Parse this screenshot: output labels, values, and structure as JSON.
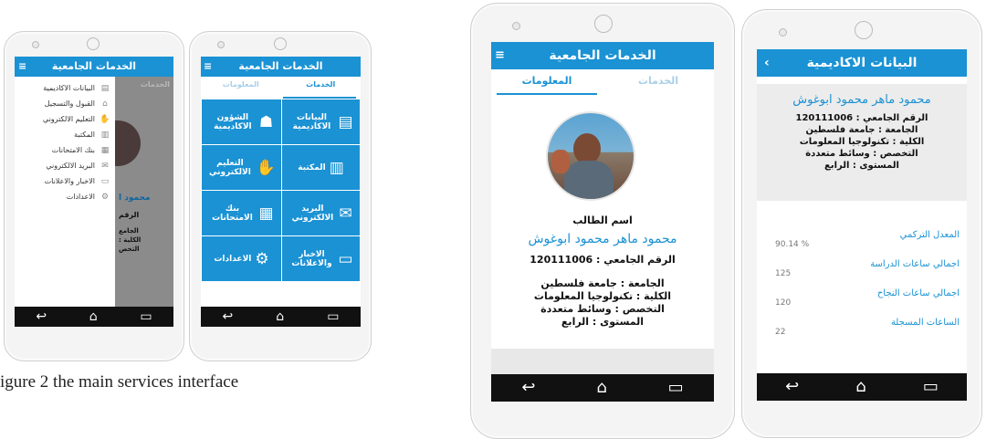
{
  "caption": "igure 2 the main services interface",
  "phone1": {
    "header_title": "الخدمات الجامعية",
    "menu_icon": "hamburger-icon",
    "behind_tab": "الخدمات",
    "behind_name": "محمود ا",
    "behind_lines": [
      "الرقم",
      "الجامع",
      "الكلية :",
      "التخص"
    ],
    "menu": [
      {
        "label": "البيانات الاكاديمية",
        "icon": "id-card-icon"
      },
      {
        "label": "القبول والتسجيل",
        "icon": "building-icon"
      },
      {
        "label": "التعليم الالكتروني",
        "icon": "handshake-icon"
      },
      {
        "label": "المكتبة",
        "icon": "books-icon"
      },
      {
        "label": "بنك الامتحانات",
        "icon": "document-icon"
      },
      {
        "label": "البريد الالكتروني",
        "icon": "envelope-icon"
      },
      {
        "label": "الاخبار والاعلانات",
        "icon": "monitor-icon"
      },
      {
        "label": "الاعدادات",
        "icon": "gear-icon"
      }
    ]
  },
  "phone2": {
    "header_title": "الخدمات الجامعية",
    "tab_services": "الخدمات",
    "tab_info": "المعلومات",
    "tiles": [
      {
        "label": "البيانات الاكاديمية",
        "icon": "id-card-icon"
      },
      {
        "label": "الشؤون الاكاديمية",
        "icon": "people-icon"
      },
      {
        "label": "المكتبة",
        "icon": "books-icon"
      },
      {
        "label": "التعليم الالكتروني",
        "icon": "handshake-icon"
      },
      {
        "label": "البريد الالكتروني",
        "icon": "envelope-icon"
      },
      {
        "label": "بنك الامتحانات",
        "icon": "document-icon"
      },
      {
        "label": "الاخبار والاعلانات",
        "icon": "monitor-icon"
      },
      {
        "label": "الاعدادات",
        "icon": "gear-icon"
      }
    ]
  },
  "phone3": {
    "header_title": "الخدمات الجامعية",
    "tab_services": "الخدمات",
    "tab_info": "المعلومات",
    "student_label": "اسم الطالب",
    "student_name": "محمود ماهر محمود ابوغوش",
    "lines": [
      "الرقم الجامعي : 120111006",
      "الجامعة : جامعة فلسطين",
      "الكلية : تكنولوجيا المعلومات",
      "التخصص : وسائط متعددة",
      "المستوى : الرابع"
    ]
  },
  "phone4": {
    "header_title": "البيانات الاكاديمية",
    "back_icon": "chevron-left-icon",
    "student_name": "محمود ماهر محمود ابوغوش",
    "lines": [
      "الرقم الجامعي : 120111006",
      "الجامعة : جامعة فلسطين",
      "الكلية : تكنولوجيا المعلومات",
      "التخصص : وسائط متعددة",
      "المستوى : الرابع"
    ],
    "stats": [
      {
        "label": "المعدل التركمي",
        "value": "% 90.14"
      },
      {
        "label": "اجمالي ساعات الدراسة",
        "value": "125"
      },
      {
        "label": "اجمالي ساعات النجاح",
        "value": "120"
      },
      {
        "label": "الساعات المسجلة",
        "value": "22"
      }
    ]
  },
  "navbar": {
    "back": "↩",
    "home": "⌂",
    "recent": "▭"
  }
}
